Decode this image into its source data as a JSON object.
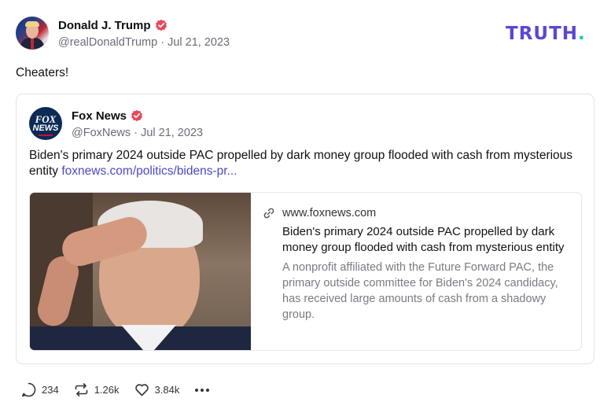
{
  "post": {
    "author_name": "Donald J. Trump",
    "handle": "@realDonaldTrump",
    "separator": "·",
    "date": "Jul 21, 2023",
    "text": "Cheaters!",
    "verified_icon": "verified-badge-icon"
  },
  "brand": {
    "logo_text": "TRUTH",
    "logo_dot": ".",
    "logo_color": "#5848d5",
    "dot_color": "#17c9b0"
  },
  "quote": {
    "author_name": "Fox News",
    "avatar_top": "FOX",
    "avatar_bottom": "NEWS",
    "handle": "@FoxNews",
    "separator": "·",
    "date": "Jul 21, 2023",
    "text": "Biden's primary 2024 outside PAC propelled by dark money group flooded with cash from mysterious entity",
    "link_text": "foxnews.com/politics/bidens-pr..."
  },
  "link_card": {
    "domain": "www.foxnews.com",
    "title": "Biden's primary 2024 outside PAC propelled by dark money group flooded with cash from mysterious entity",
    "description": "A nonprofit affiliated with the Future Forward PAC, the primary outside committee for Biden's 2024 candidacy, has received large amounts of cash from a shadowy group.",
    "image_subject": "Joe Biden photo"
  },
  "actions": {
    "replies": "234",
    "retruths": "1.26k",
    "likes": "3.84k"
  },
  "colors": {
    "verified": "#e8495a",
    "link": "#4b47c8",
    "muted_text": "#6b6b7a"
  }
}
